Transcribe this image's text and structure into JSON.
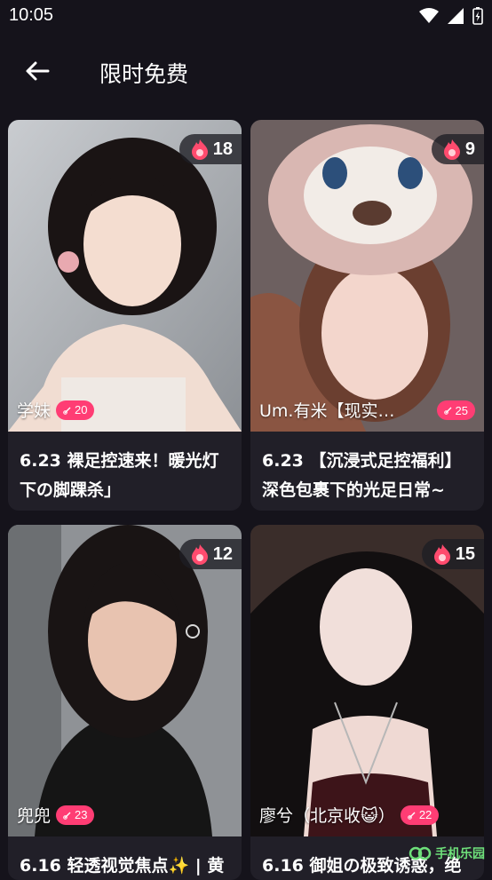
{
  "status_bar": {
    "time": "10:05"
  },
  "header": {
    "title": "限时免费"
  },
  "cards": [
    {
      "fire": "18",
      "author": "学妹",
      "pill": "20",
      "caption": "6.23 裸足控速来！暖光灯下の脚踝杀」"
    },
    {
      "fire": "9",
      "author": "Um.有米【现实…",
      "pill": "25",
      "caption": "6.23 【沉浸式足控福利】深色包裹下的光足日常~"
    },
    {
      "fire": "12",
      "author": "兜兜",
      "pill": "23",
      "caption": "6.16 轻透视觉焦点✨ | 黄"
    },
    {
      "fire": "15",
      "author": "廖兮（北京收😺）",
      "pill": "22",
      "caption": "6.16 御姐の极致诱惑，绝"
    }
  ],
  "watermark": {
    "text": "手机乐园"
  },
  "colors": {
    "background": "#15131b",
    "card": "#211f28",
    "accent_pink": "#ff3d74"
  }
}
